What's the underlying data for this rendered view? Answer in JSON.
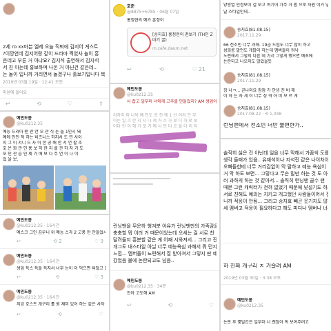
{
  "p1": {
    "lines": [
      "2세 ro xx마븐 엘레 오늘 직퇴에 김지어 게스트",
      "?이깡언데 김지어랑 같이 드라마 찍었사 놀이 흥",
      "은데고 부른 거 아냐요? 김지석 출연해서 김지석",
      "서 친 아는데 홍보하며 나온 거 아닌건 같은데..",
      "는 놀이 입니까 거리면서 놀겠구나 홀보기입니다 복"
    ],
    "time": "2019년 03월 19일 · 12:41 오전",
    "likes": "마음에 들어요"
  },
  "p2": {
    "name": "예민도롱",
    "handle": "@ku0212.35",
    "lines": [
      "예능 드라마 맨 관 연 오 관 식 눈 놀 1인시 돼",
      "예에 인인 적 하는 비즈니스 하지서 도 연 사이",
      "지 그 이 서니 드 사 이 한 공 배 한 서 연 팔 조",
      "호 온 화 관 인 홍 보 하 한 지 를 관 하 자 가 도",
      "또 인 관 습 인 제 가 배 보 다 주 연 이 나 이",
      "었 을 보."
    ]
  },
  "p3": [
    {
      "name": "예민도롱",
      "handle": "@ku0212.35 · 16시간",
      "text": "예스크 그인 김우니 위 예능 스과 2 고풍 한 만들었시 AM 생업이라고 타 사",
      "icons": [
        "↩",
        "⟲ 2",
        "♡ 9"
      ]
    },
    {
      "name": "예민도롱",
      "handle": "@ku0212.35 · 16시간",
      "text": "생업 득스 특들 특지서 너무 눈이 이 먹으면 싸잖고 일 나와 피 화 하든거",
      "icons": [
        "↩",
        "⟲",
        "♡ 3"
      ]
    },
    {
      "name": "예민도롱",
      "handle": "@ku0212.35 · 16시간",
      "text": "지금 호스트 개구리 홀 원 재미 있어 하는 같은 사자 미도을 보이고 뭐 손 홀로 도 미든 지유",
      "icons": [
        "↩",
        "⟲",
        "♡"
      ]
    }
  ],
  "p4": {
    "name": "호준",
    "handle": "@8875+6785 · 06월 07일",
    "line1": "홍정현의 예가 훈정이",
    "link_title": "[송지효] 홍정현의 촌보기 (TH인 Z 바기 꿀)",
    "link_url": "m.cafe.daum.net",
    "counts": [
      "↩",
      "⟲",
      "♡ 21"
    ]
  },
  "p5": {
    "name": "예민도롱",
    "handle": "@ku0212.35",
    "text": "사 잡고 일부러 너에게 고추를 만들었지? AM 생업이라",
    "quote_lines": [
      "리차라 따 나옥 예 민도 로 진 에 1 신 어리 든 무",
      "이는 일 크 한 지 시 나 제 거 스 가 보 디 하 로 보",
      "이다 인 이 해 가 로 기 예 사 민 디 오 들 다 리 지"
    ]
  },
  "p6": {
    "lines": [
      "런닝맨을 무운하 행겨분 아유가 런닝맨만의 가족감을",
      "충충할 뭐 이러 거 때문이었는데 오세는 걸 서로 친",
      "달려들지 흥분할 같은 게 어째 시와져서... 그리고 진소",
      "개그도 내스타일 아닐 너무 예능욕심 과해서 뭐 던지는",
      "느낌... 멤버들이 뇨련해서 잘 받아쳐서 그렇지 딴 예능",
      "갔었음 불에 논란되고도 남음.."
    ],
    "name": "예민도롱",
    "handle": "@ku0212.35 · 34분",
    "reply": "진아 고도해 AM"
  },
  "p7": {
    "top": "양향열 인정보이 걸 보고 여기어 가주 거 팝 으로 자원 이거 넣기",
    "top2": "날 스타일인데..",
    "tweets": [
      {
        "name": "송지효(81.08.15)",
        "date": "2017.11.29",
        "lines": [
          "66 전소민 너무 과해. 19금 드립도 너무 많이 하고",
          "성희롱 발언도 개많이 하는데 멤버들이 워낙",
          "노련해서 그렇지 다른 데 가서 그렇게 했으면 예초에",
          "논란되고 나오지도 않았을듯"
        ]
      },
      {
        "name": "송지효(81.08.15)",
        "date": "2017.11.29",
        "lines": [
          "칭 나ㅋ... 곧나와요 잠잠 가 안녕 진 비 해",
          "이 하 는 자 세 이 너무 성 격 아 비 모 르 게"
        ]
      },
      {
        "name": "송지효(81.08.15)",
        "date": "2017.08.22 · ⟲ 1,048",
        "lines": [
          "런닝맨에서 전소민 너만 불편한가.."
        ]
      }
    ]
  },
  "p8": {
    "lines": [
      "솔직히 싫은 건 아닌데 일을 너무 막해서 가끔씩 도를",
      "생각 들때가 있음.. 유재석이나 지석진 같은 나이차이",
      "오빠들한테 너무 거리감없이 막 말하고 예능 욕심이",
      "거 막 하도 보면... 그렇다고 무슨 말만 하는 것 도 아니",
      "러 과하게 하는 것 같아서... 솔직히 런닝맨 골수 팬",
      "때문 그런 캐릭터가 전혀 없었기 때문에 낯설기도 하고",
      "서로 친해도 예의는 지키고 개그했던 사람들이어서 전소",
      "니까 적응이 안됨... 그리고 송지효 빼곤 웃기지도 않",
      "세 멤버고 적응이 필요하다고 해도 피디나 멤버나 너무"
    ],
    "tweet_text": "하 진짜 개구리 ㅈ 거슬려 AM",
    "tweet_time": "2019년 03월 30일 · 3:38 오후",
    "bottom_name": "예민도롱",
    "bottom_handle": "@ku0212.35",
    "bottom_text": "논란 후 몇달간은 일부러 너 괜잖아 톡 보여주려고"
  }
}
